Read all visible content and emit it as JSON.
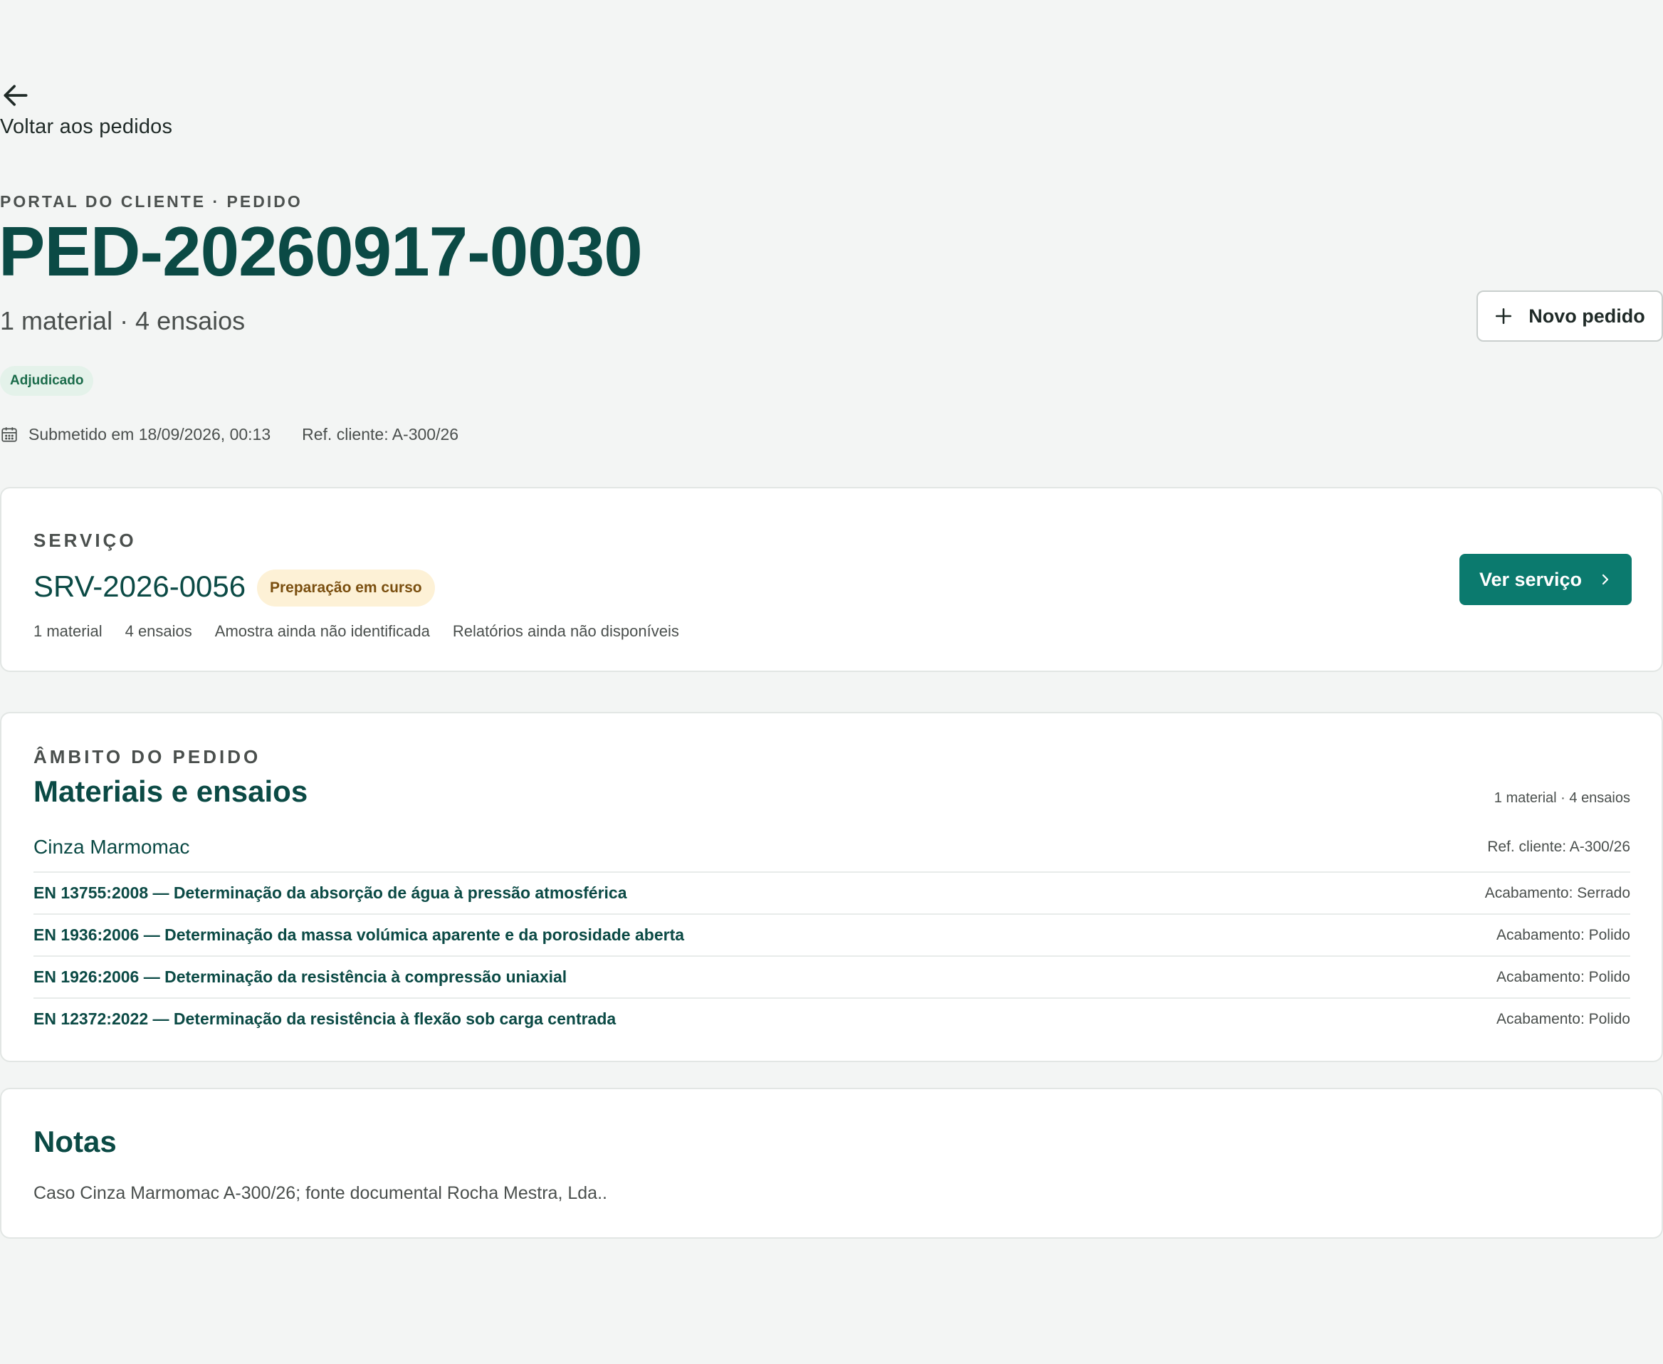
{
  "back": {
    "label": "Voltar aos pedidos",
    "icon": "arrow-left-icon"
  },
  "header": {
    "eyebrow": "PORTAL DO CLIENTE · PEDIDO",
    "title": "PED-20260917-0030",
    "subtitle": "1 material · 4 ensaios",
    "status_badge": "Adjudicado",
    "submitted": "Submetido em 18/09/2026, 00:13",
    "client_ref": "Ref. cliente: A-300/26",
    "new_order_label": "Novo pedido"
  },
  "service": {
    "section_label": "SERVIÇO",
    "code": "SRV-2026-0056",
    "status_badge": "Preparação em curso",
    "stats": [
      "1 material",
      "4 ensaios",
      "Amostra ainda não identificada",
      "Relatórios ainda não disponíveis"
    ],
    "view_label": "Ver serviço"
  },
  "scope": {
    "section_label": "ÂMBITO DO PEDIDO",
    "title": "Materiais e ensaios",
    "count": "1 material · 4 ensaios",
    "material": {
      "name": "Cinza Marmomac",
      "ref": "Ref. cliente: A-300/26"
    },
    "tests": [
      {
        "name": "EN 13755:2008 — Determinação da absorção de água à pressão atmosférica",
        "finish": "Acabamento: Serrado"
      },
      {
        "name": "EN 1936:2006 — Determinação da massa volúmica aparente e da porosidade aberta",
        "finish": "Acabamento: Polido"
      },
      {
        "name": "EN 1926:2006 — Determinação da resistência à compressão uniaxial",
        "finish": "Acabamento: Polido"
      },
      {
        "name": "EN 12372:2022 — Determinação da resistência à flexão sob carga centrada",
        "finish": "Acabamento: Polido"
      }
    ]
  },
  "notes": {
    "title": "Notas",
    "text": "Caso Cinza Marmomac A-300/26; fonte documental Rocha Mestra, Lda.."
  },
  "colors": {
    "primary": "#0b7a6e",
    "heading": "#0b4a45",
    "success_bg": "#e4f2ea",
    "warning_bg": "#fdf1d6",
    "background": "#f3f5f4"
  }
}
